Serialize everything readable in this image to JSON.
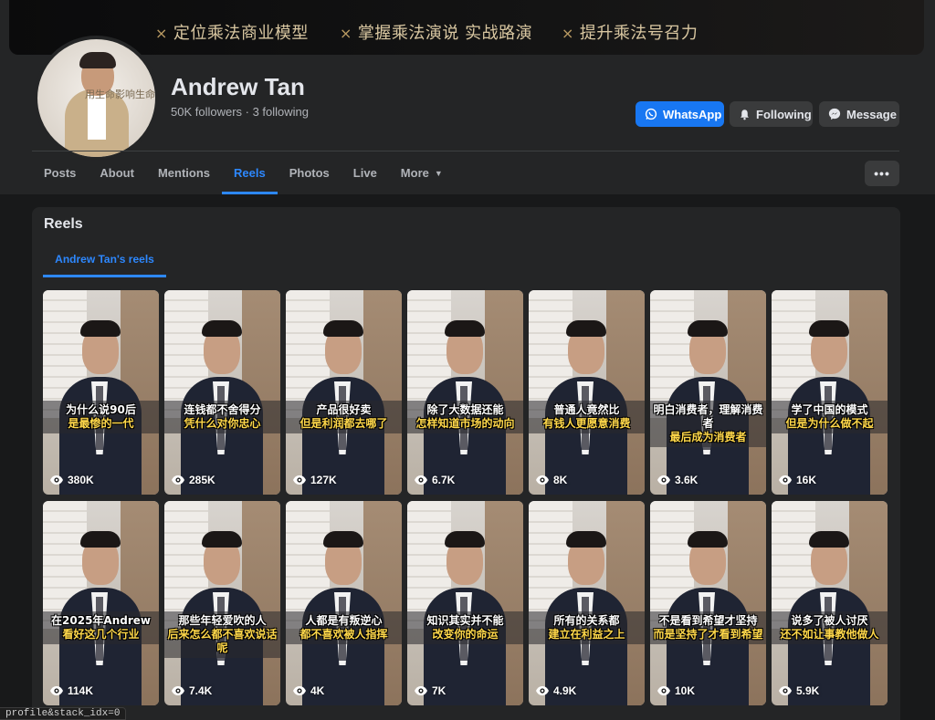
{
  "cover": {
    "taglines": [
      "定位乘法商业模型",
      "掌握乘法演说 实战路演",
      "提升乘法号召力"
    ],
    "mark": "×",
    "accent_color": "#d9c7a1"
  },
  "avatar": {
    "signature": "用生命影响生命"
  },
  "profile": {
    "name": "Andrew Tan",
    "stats": "50K followers · 3 following"
  },
  "actions": {
    "whatsapp": "WhatsApp",
    "following": "Following",
    "message": "Message"
  },
  "tabs": [
    {
      "label": "Posts"
    },
    {
      "label": "About"
    },
    {
      "label": "Mentions"
    },
    {
      "label": "Reels",
      "active": true
    },
    {
      "label": "Photos"
    },
    {
      "label": "Live"
    },
    {
      "label": "More"
    }
  ],
  "more_dots": "•••",
  "reels": {
    "title": "Reels",
    "subtab": "Andrew Tan's reels",
    "items": [
      {
        "line1": "为什么说90后",
        "line2": "是最惨的一代",
        "views": "380K"
      },
      {
        "line1": "连钱都不舍得分",
        "line2": "凭什么对你忠心",
        "views": "285K"
      },
      {
        "line1": "产品很好卖",
        "line2": "但是利润都去哪了",
        "views": "127K"
      },
      {
        "line1": "除了大数据还能",
        "line2": "怎样知道市场的动向",
        "views": "6.7K"
      },
      {
        "line1": "普通人竟然比",
        "line2": "有钱人更愿意消费",
        "views": "8K"
      },
      {
        "line1": "明白消费者，理解消费者",
        "line2": "最后成为消费者",
        "views": "3.6K"
      },
      {
        "line1": "学了中国的模式",
        "line2": "但是为什么做不起",
        "views": "16K"
      },
      {
        "line1": "在2025年Andrew",
        "line2": "看好这几个行业",
        "views": "114K"
      },
      {
        "line1": "那些年轻爱吹的人",
        "line2": "后来怎么都不喜欢说话呢",
        "views": "7.4K"
      },
      {
        "line1": "人都是有叛逆心",
        "line2": "都不喜欢被人指挥",
        "views": "4K"
      },
      {
        "line1": "知识其实并不能",
        "line2": "改变你的命运",
        "views": "7K"
      },
      {
        "line1": "所有的关系都",
        "line2": "建立在利益之上",
        "views": "4.9K"
      },
      {
        "line1": "不是看到希望才坚持",
        "line2": "而是坚持了才看到希望",
        "views": "10K"
      },
      {
        "line1": "说多了被人讨厌",
        "line2": "还不如让事教他做人",
        "views": "5.9K"
      }
    ]
  },
  "status": {
    "text": "profile&stack_idx=0"
  },
  "colors": {
    "background": "#18191a",
    "surface": "#242526",
    "accent": "#2d88ff",
    "whatsapp_button": "#1877f2"
  }
}
